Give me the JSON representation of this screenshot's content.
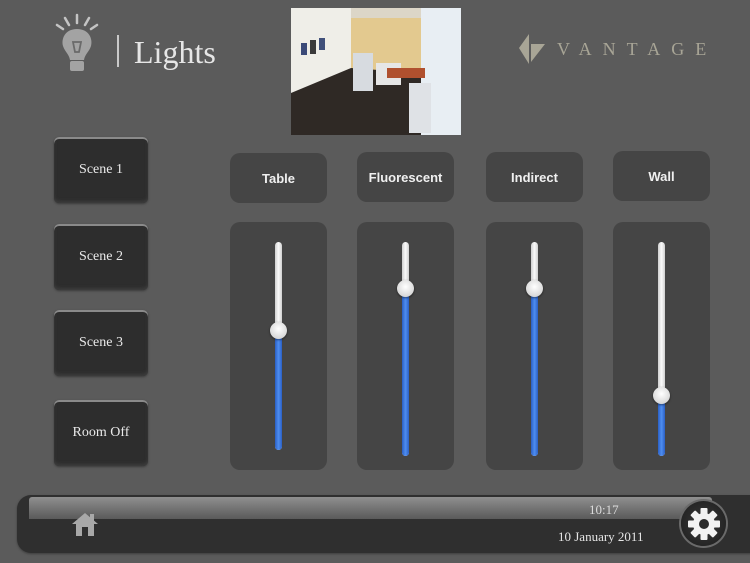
{
  "header": {
    "title": "Lights",
    "section_icon": "lightbulb-icon",
    "brand": "VANTAGE",
    "brand_icon": "vantage-logo-icon",
    "camera_feed": "room-camera-view"
  },
  "scenes": [
    {
      "label": "Scene 1"
    },
    {
      "label": "Scene 2"
    },
    {
      "label": "Scene 3"
    },
    {
      "label": "Room Off"
    }
  ],
  "channels": [
    {
      "label": "Table",
      "level_percent": 57
    },
    {
      "label": "Fluorescent",
      "level_percent": 78
    },
    {
      "label": "Indirect",
      "level_percent": 78
    },
    {
      "label": "Wall",
      "level_percent": 28
    }
  ],
  "footer": {
    "time": "10:17",
    "date": "10 January 2011",
    "home_icon": "home-icon",
    "settings_icon": "gear-icon"
  },
  "colors": {
    "background": "#5b5b5b",
    "slider_fill": "#3f7de0",
    "panel": "#454545"
  }
}
